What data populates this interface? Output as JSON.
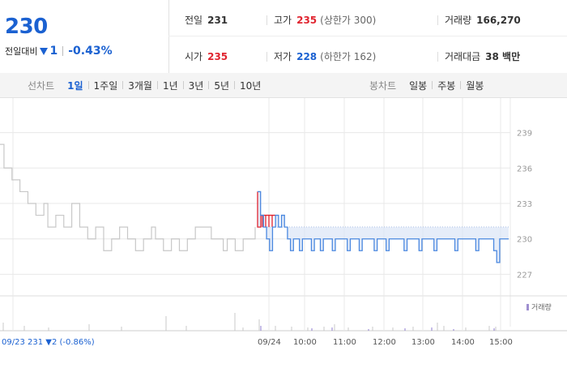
{
  "summary": {
    "price": "230",
    "change_label": "전일대비",
    "change_value": "1",
    "change_pct": "-0.43%",
    "prev_close_label": "전일",
    "prev_close": "231",
    "open_label": "시가",
    "open": "235",
    "high_label": "고가",
    "high": "235",
    "upper_limit": "(상한가 300)",
    "low_label": "저가",
    "low": "228",
    "lower_limit": "(하한가 162)",
    "volume_label": "거래량",
    "volume": "166,270",
    "amount_label": "거래대금",
    "amount": "38 백만"
  },
  "tabs": {
    "line_title": "선차트",
    "line_tabs": [
      "1일",
      "1주일",
      "3개월",
      "1년",
      "3년",
      "5년",
      "10년"
    ],
    "candle_title": "봉차트",
    "candle_tabs": [
      "일봉",
      "주봉",
      "월봉"
    ]
  },
  "colors": {
    "up": "#e0242f",
    "down": "#1b61d1",
    "grid": "#e8e8e8",
    "prev_line": "#c8c8c8"
  },
  "chart_data": {
    "type": "line",
    "y_ticks": [
      239,
      236,
      233,
      230,
      227
    ],
    "ylim": [
      226,
      240
    ],
    "x_ticks": [
      "09/23",
      "09/24",
      "10:00",
      "11:00",
      "12:00",
      "13:00",
      "14:00",
      "15:00"
    ],
    "prev_close_level": 231,
    "prev_label": "09/23  231 ▼2 (-0.86%)",
    "volume_legend": "거래량",
    "series": [
      {
        "values": [
          238,
          236,
          236,
          235,
          235,
          234,
          234,
          233,
          233,
          232,
          232,
          233,
          231,
          231,
          232,
          232,
          231,
          231,
          233,
          233,
          231,
          231,
          230,
          230,
          231,
          231,
          229,
          229,
          230,
          230,
          231,
          231,
          230,
          230,
          229,
          229,
          230,
          230,
          231,
          230,
          230,
          229,
          229,
          230,
          230,
          229,
          229,
          230,
          230,
          231,
          231,
          231,
          231,
          230,
          230,
          230,
          229,
          230,
          230,
          229,
          229,
          230,
          230,
          230,
          231
        ]
      },
      {
        "values": [
          234,
          232,
          231,
          230,
          229,
          231,
          232,
          231,
          232,
          231,
          230,
          229,
          230,
          230,
          229,
          230,
          230,
          230,
          229,
          230,
          230,
          229,
          230,
          230,
          230,
          229,
          230,
          230,
          230,
          230,
          229,
          230,
          230,
          230,
          229,
          230,
          230,
          230,
          230,
          229,
          230,
          230,
          230,
          229,
          230,
          230,
          230,
          230,
          230,
          229,
          230,
          230,
          230,
          230,
          229,
          230,
          230,
          230,
          230,
          229,
          230,
          230,
          230,
          230,
          230,
          230,
          229,
          230,
          230,
          230,
          230,
          230,
          230,
          229,
          230,
          230,
          230,
          230,
          230,
          229,
          228,
          230,
          230,
          230,
          230
        ]
      }
    ]
  }
}
